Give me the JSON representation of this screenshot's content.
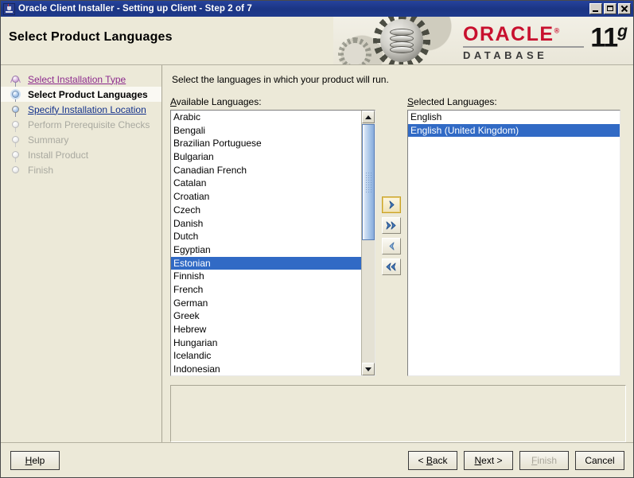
{
  "window": {
    "title": "Oracle Client Installer - Setting up Client - Step 2 of 7",
    "icon": "java-coffee-cup-icon",
    "minimize_label": "Minimize",
    "maximize_label": "Maximize",
    "close_label": "Close"
  },
  "header": {
    "page_title": "Select Product Languages",
    "brand_name": "ORACLE",
    "brand_trademark": "®",
    "brand_product": "DATABASE",
    "brand_version_number": "11",
    "brand_version_suffix": "g"
  },
  "sidebar": {
    "items": [
      {
        "label": "Select Installation Type",
        "state": "done"
      },
      {
        "label": "Select Product Languages",
        "state": "current"
      },
      {
        "label": "Specify Installation Location",
        "state": "link"
      },
      {
        "label": "Perform Prerequisite Checks",
        "state": "pending"
      },
      {
        "label": "Summary",
        "state": "pending"
      },
      {
        "label": "Install Product",
        "state": "pending"
      },
      {
        "label": "Finish",
        "state": "pending"
      }
    ]
  },
  "main": {
    "instruction": "Select the languages in which your product will run.",
    "available": {
      "caption_accel": "A",
      "caption_rest": "vailable Languages:",
      "items": [
        {
          "label": "Arabic",
          "selected": false
        },
        {
          "label": "Bengali",
          "selected": false
        },
        {
          "label": "Brazilian Portuguese",
          "selected": false
        },
        {
          "label": "Bulgarian",
          "selected": false
        },
        {
          "label": "Canadian French",
          "selected": false
        },
        {
          "label": "Catalan",
          "selected": false
        },
        {
          "label": "Croatian",
          "selected": false
        },
        {
          "label": "Czech",
          "selected": false
        },
        {
          "label": "Danish",
          "selected": false
        },
        {
          "label": "Dutch",
          "selected": false
        },
        {
          "label": "Egyptian",
          "selected": false
        },
        {
          "label": "Estonian",
          "selected": true
        },
        {
          "label": "Finnish",
          "selected": false
        },
        {
          "label": "French",
          "selected": false
        },
        {
          "label": "German",
          "selected": false
        },
        {
          "label": "Greek",
          "selected": false
        },
        {
          "label": "Hebrew",
          "selected": false
        },
        {
          "label": "Hungarian",
          "selected": false
        },
        {
          "label": "Icelandic",
          "selected": false
        },
        {
          "label": "Indonesian",
          "selected": false
        }
      ]
    },
    "selected": {
      "caption_accel": "S",
      "caption_rest": "elected Languages:",
      "items": [
        {
          "label": "English",
          "selected": false
        },
        {
          "label": "English (United Kingdom)",
          "selected": true
        }
      ]
    },
    "transfer_buttons": [
      {
        "name": "move-right-button",
        "icon": "chevron-right-icon",
        "focused": true
      },
      {
        "name": "move-all-right-button",
        "icon": "double-chevron-right-icon",
        "focused": false
      },
      {
        "name": "move-left-button",
        "icon": "chevron-left-icon",
        "focused": false
      },
      {
        "name": "move-all-left-button",
        "icon": "double-chevron-left-icon",
        "focused": false
      }
    ],
    "message_panel_text": ""
  },
  "footer": {
    "help": {
      "accel": "H",
      "rest": "elp"
    },
    "back": {
      "prefix": "< ",
      "accel": "B",
      "rest": "ack"
    },
    "next": {
      "accel": "N",
      "rest": "ext",
      "suffix": " >"
    },
    "finish": {
      "accel": "F",
      "rest": "inish",
      "disabled": true
    },
    "cancel": {
      "label": "Cancel"
    }
  },
  "colors": {
    "titlebar": "#1f3a8c",
    "surface": "#ece9d8",
    "selection": "#316ac5",
    "oracle_red": "#c8102e",
    "link": "#14328c",
    "visited_link": "#8d2a8d",
    "disabled_text": "#a9a9a0"
  }
}
